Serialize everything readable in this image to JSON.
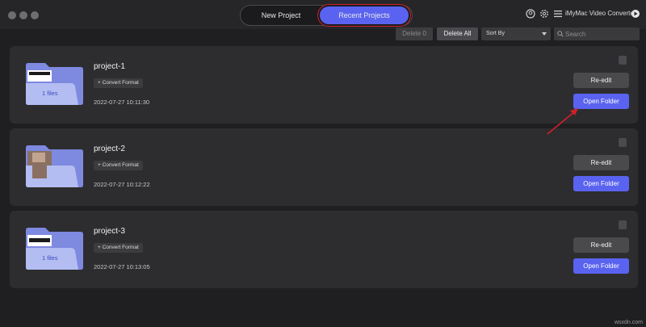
{
  "window": {
    "app_name": "iMyMac Video Converter",
    "tabs": [
      {
        "label": "New Project",
        "active": false
      },
      {
        "label": "Recent Projects",
        "active": true
      }
    ]
  },
  "toolbar": {
    "delete_selected": "Delete 0",
    "delete_all": "Delete All",
    "sort_label": "Sort By",
    "search_placeholder": "Search"
  },
  "projects": [
    {
      "name": "project-1",
      "tag": "+ Convert Format",
      "date": "2022-07-27 10:11:30",
      "files": "1 files",
      "reedit": "Re-edit",
      "open": "Open Folder"
    },
    {
      "name": "project-2",
      "tag": "+ Convert Format",
      "date": "2022-07-27 10:12:22",
      "files": "",
      "reedit": "Re-edit",
      "open": "Open Folder"
    },
    {
      "name": "project-3",
      "tag": "+ Convert Format",
      "date": "2022-07-27 10:13:05",
      "files": "1 files",
      "reedit": "Re-edit",
      "open": "Open Folder"
    }
  ],
  "watermark": "wsxdn.com",
  "colors": {
    "accent": "#5a63f0",
    "highlight": "#d21f2a",
    "background": "#1f1f21",
    "card": "#2d2d2f"
  }
}
